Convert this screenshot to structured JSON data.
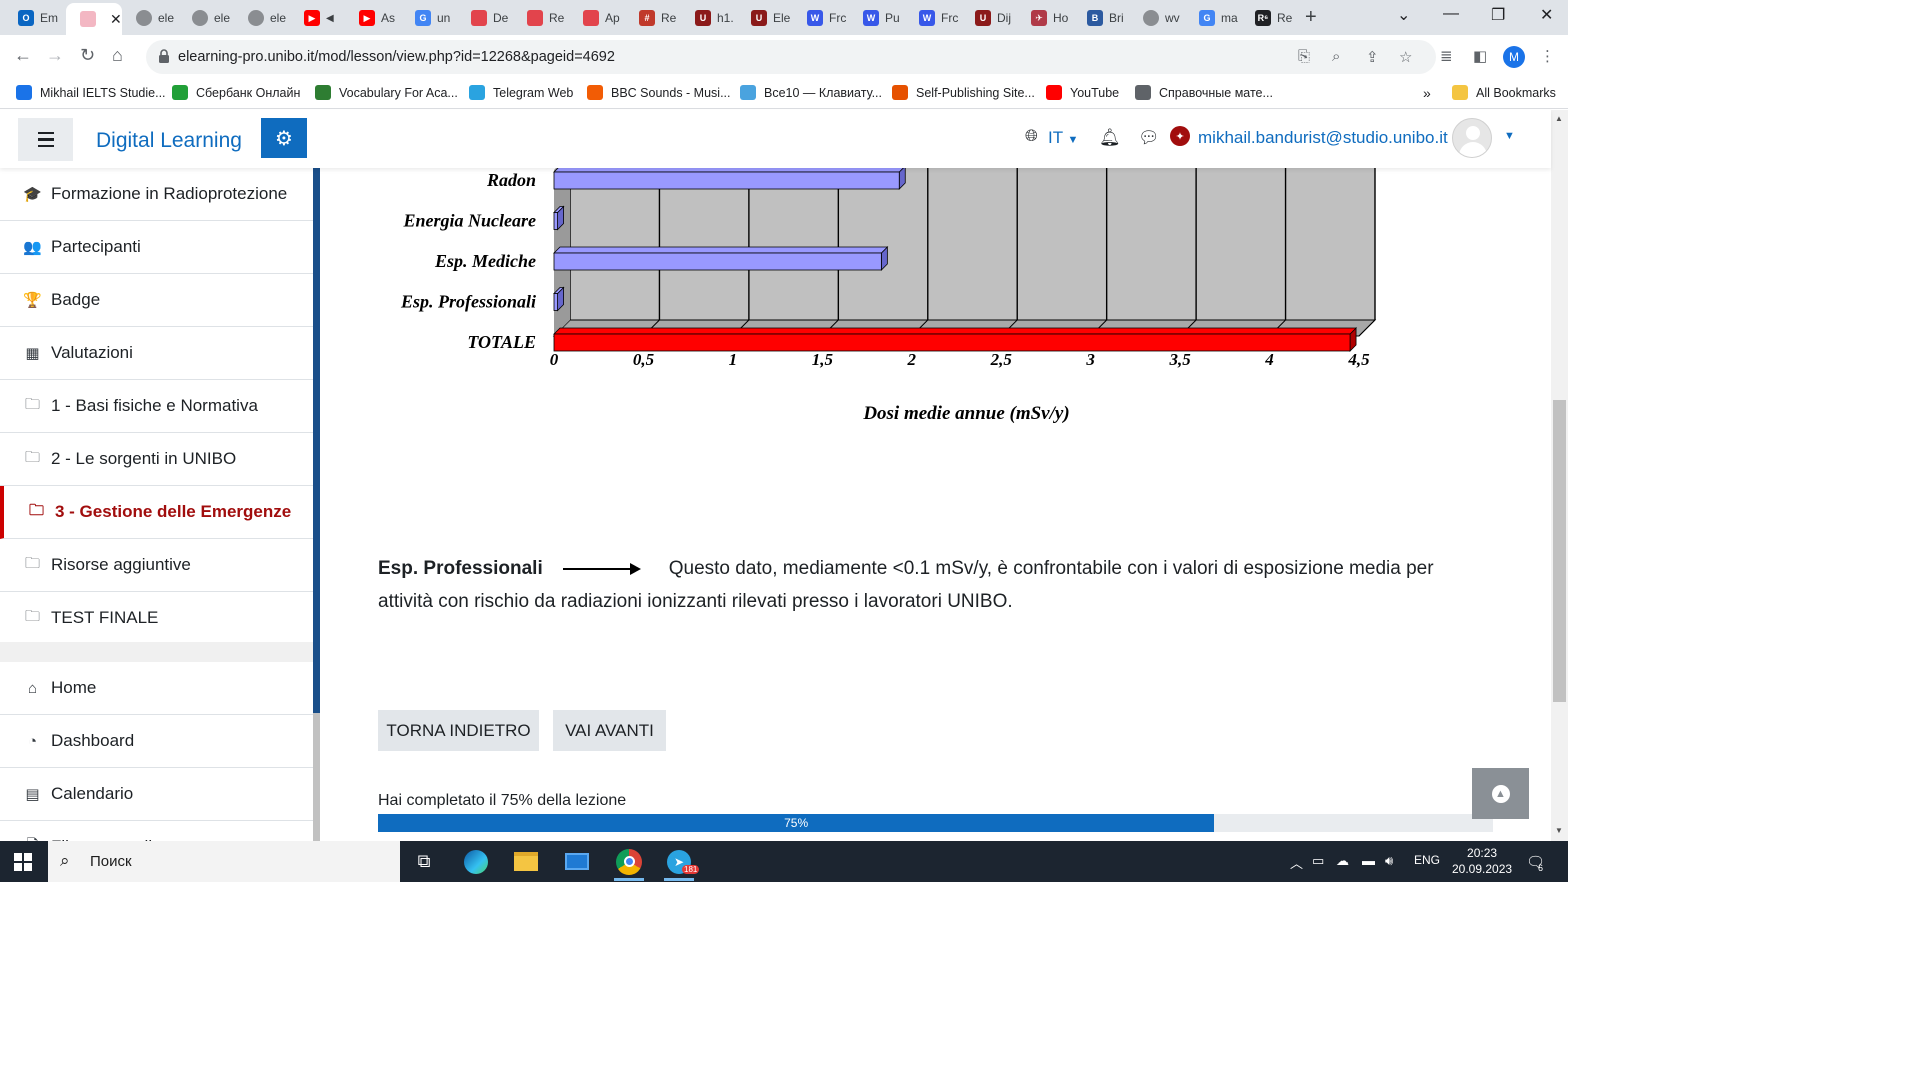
{
  "browser": {
    "tabs": [
      {
        "label": "Em",
        "color": "#0a66c2",
        "glyph": "O"
      },
      {
        "label": "",
        "color": "#f3b7c3",
        "glyph": "",
        "active": true
      },
      {
        "label": "ele",
        "color": "#5f6368",
        "glyph": ""
      },
      {
        "label": "ele",
        "color": "#5f6368",
        "glyph": ""
      },
      {
        "label": "ele",
        "color": "#5f6368",
        "glyph": ""
      },
      {
        "label": "",
        "color": "#ff0000",
        "glyph": "▶",
        "muted": true
      },
      {
        "label": "As",
        "color": "#ff0000",
        "glyph": "▶"
      },
      {
        "label": "un",
        "color": "#4285f4",
        "glyph": "G"
      },
      {
        "label": "De",
        "color": "#e2444c",
        "glyph": ""
      },
      {
        "label": "Re",
        "color": "#e2444c",
        "glyph": ""
      },
      {
        "label": "Ap",
        "color": "#e2444c",
        "glyph": ""
      },
      {
        "label": "Re",
        "color": "#c0392b",
        "glyph": "#"
      },
      {
        "label": "h1.",
        "color": "#8b1a1a",
        "glyph": "U"
      },
      {
        "label": "Ele",
        "color": "#8b1a1a",
        "glyph": "U"
      },
      {
        "label": "Frc",
        "color": "#3858e9",
        "glyph": "W"
      },
      {
        "label": "Pu",
        "color": "#3858e9",
        "glyph": "W"
      },
      {
        "label": "Frc",
        "color": "#3858e9",
        "glyph": "W"
      },
      {
        "label": "Dij",
        "color": "#8b1a1a",
        "glyph": "U"
      },
      {
        "label": "Ho",
        "color": "#b03a48",
        "glyph": "✈"
      },
      {
        "label": "Bri",
        "color": "#2c5aa0",
        "glyph": "B"
      },
      {
        "label": "wv",
        "color": "#5f6368",
        "glyph": ""
      },
      {
        "label": "ma",
        "color": "#4285f4",
        "glyph": "G"
      },
      {
        "label": "Re",
        "color": "#202124",
        "glyph": "R⁶"
      }
    ],
    "url": "elearning-pro.unibo.it/mod/lesson/view.php?id=12268&pageid=4692",
    "profile_initial": "M",
    "bookmarks": [
      {
        "label": "Mikhail IELTS Studie...",
        "color": "#1a73e8"
      },
      {
        "label": "Сбербанк Онлайн",
        "color": "#21a038"
      },
      {
        "label": "Vocabulary For Aca...",
        "color": "#2e7d32"
      },
      {
        "label": "Telegram Web",
        "color": "#2aa3e0"
      },
      {
        "label": "BBC Sounds - Musi...",
        "color": "#f25c05"
      },
      {
        "label": "Все10 — Клавиату...",
        "color": "#4aa3df"
      },
      {
        "label": "Self-Publishing Site...",
        "color": "#e65100"
      },
      {
        "label": "YouTube",
        "color": "#ff0000"
      },
      {
        "label": "Справочные мате...",
        "color": "#5f6368"
      }
    ],
    "bookmarks_overflow": "»",
    "all_bookmarks": "All Bookmarks"
  },
  "navbar": {
    "site_name": "Digital Learning",
    "language": "IT",
    "user_email": "mikhail.bandurist@studio.unibo.it"
  },
  "drawer": {
    "items": [
      {
        "label": "Formazione in Radioprotezione",
        "icon": "graduation-cap-icon",
        "glyph": "🎓"
      },
      {
        "label": "Partecipanti",
        "icon": "users-icon",
        "glyph": "👥"
      },
      {
        "label": "Badge",
        "icon": "trophy-icon",
        "glyph": "🏆"
      },
      {
        "label": "Valutazioni",
        "icon": "table-icon",
        "glyph": "▦"
      },
      {
        "label": "1 - Basi fisiche e Normativa",
        "icon": "folder-icon",
        "glyph": "🗀"
      },
      {
        "label": "2 - Le sorgenti in UNIBO",
        "icon": "folder-icon",
        "glyph": "🗀"
      },
      {
        "label": "3 - Gestione delle Emergenze",
        "icon": "folder-icon",
        "glyph": "🗀",
        "active": true
      },
      {
        "label": "Risorse aggiuntive",
        "icon": "folder-icon",
        "glyph": "🗀"
      },
      {
        "label": "TEST FINALE",
        "icon": "folder-icon",
        "glyph": "🗀"
      }
    ],
    "secondary": [
      {
        "label": "Home",
        "icon": "home-icon",
        "glyph": "⌂"
      },
      {
        "label": "Dashboard",
        "icon": "dashboard-icon",
        "glyph": "◔"
      },
      {
        "label": "Calendario",
        "icon": "calendar-icon",
        "glyph": "▤"
      },
      {
        "label": "File personali",
        "icon": "file-icon",
        "glyph": "🗋"
      }
    ]
  },
  "chart_data": {
    "type": "bar",
    "orientation": "horizontal",
    "categories": [
      "Radon",
      "Energia Nucleare",
      "Esp. Mediche",
      "Esp. Professionali",
      "TOTALE"
    ],
    "values": [
      1.93,
      0.02,
      1.83,
      0.02,
      4.45
    ],
    "colors": [
      "#9999ff",
      "#9999ff",
      "#9999ff",
      "#9999ff",
      "#ff0000"
    ],
    "xlabel": "Dosi medie annue (mSv/y)",
    "xticks": [
      "0",
      "0,5",
      "1",
      "1,5",
      "2",
      "2,5",
      "3",
      "3,5",
      "4",
      "4,5"
    ],
    "xlim": [
      0,
      4.5
    ],
    "grid": true
  },
  "content": {
    "label": "Esp. Professionali",
    "text": "Questo dato, mediamente  <0.1 mSv/y, è  confrontabile con i valori di esposizione  media per attività con rischio da radiazioni ionizzanti rilevati presso i lavoratori UNIBO.",
    "back_button": "TORNA INDIETRO",
    "next_button": "VAI AVANTI",
    "progress_label": "Hai completato il 75% della lezione",
    "progress_percent": 75,
    "progress_text": "75%"
  },
  "taskbar": {
    "search_placeholder": "Поиск",
    "lang": "ENG",
    "time": "20:23",
    "date": "20.09.2023",
    "telegram_badge": "181",
    "notifications": "6"
  }
}
